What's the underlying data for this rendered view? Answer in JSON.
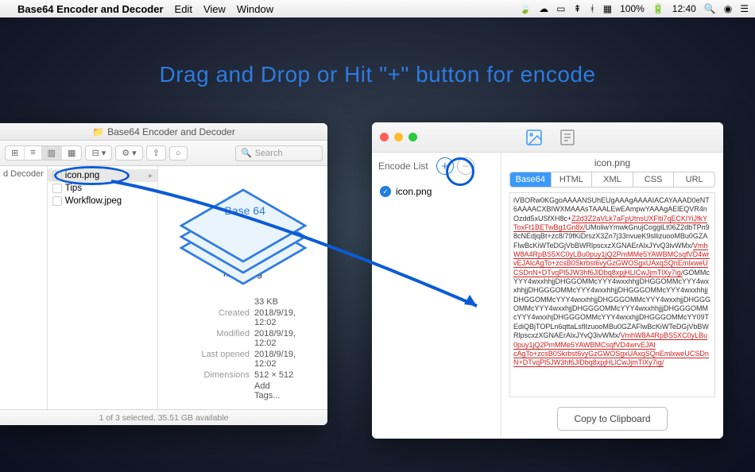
{
  "menubar": {
    "app_title": "Base64 Encoder and Decoder",
    "items": [
      "Edit",
      "View",
      "Window"
    ],
    "battery": "100%",
    "time": "12:40"
  },
  "headline": "Drag and Drop or Hit \"+\" button for encode",
  "finder": {
    "title": "Base64 Encoder and Decoder",
    "search_placeholder": "Search",
    "sidebar_item": "d Decoder",
    "files": [
      {
        "name": "icon.png",
        "selected": true
      },
      {
        "name": "Tips",
        "selected": false
      },
      {
        "name": "Workflow.jpeg",
        "selected": false
      }
    ],
    "preview": {
      "stack_label": "Base 64",
      "filename": "icon.png",
      "size": "33 KB",
      "meta": [
        {
          "k": "Created",
          "v": "2018/9/19, 12:02"
        },
        {
          "k": "Modified",
          "v": "2018/9/19, 12:02"
        },
        {
          "k": "Last opened",
          "v": "2018/9/19, 12:02"
        },
        {
          "k": "Dimensions",
          "v": "512 × 512"
        }
      ],
      "add_tags": "Add Tags..."
    },
    "status": "1 of 3 selected, 35.51 GB available"
  },
  "encoder": {
    "list_label": "Encode List",
    "items": [
      {
        "name": "icon.png"
      }
    ],
    "filename": "icon.png",
    "tabs": [
      "Base64",
      "HTML",
      "XML",
      "CSS",
      "URL"
    ],
    "active_tab": 0,
    "output_plain": "iVBORw0KGgoAAAANSUhEUgAAAgAAAAIACAYAAAD0eNT6AAAACXBIWXMAAAsTAAALEwEAmpwYAAAgAElEQVR4nOzdd5xUSfXH8c+",
    "output_red1": "Z2d3Z2aVLk7aFpUtnsUXFlti7qECKlYiJfkYToxFt1BETwBg1Gn8x/",
    "output_plain2": "UMoliwYmwkGnujCogglLt06Z2dbTPn98cNEdjqBt+zc8/79fKiDrszX3Zn7j33nvueK9sllizuooMBu0GZAFlwBcKiWTeDGjVbBWRlpscxzXGNAErAlxJYvQ3ivWMx/",
    "output_red2": "VmhW8A4RpBS5XC0yLBu0puy1jQ2PmMMe5YAWBMCsqfVD4wrvEJAlcAgTo+zcsB0Skrbst6vyGzGWOSgxUAxqSQnEmlxweUCSDnN+DTvqPl5JW3hf6JlDbq8xpjHLlCwJjmTlXy7ig/",
    "output_plain3": "GOMMcYYY4wxxhhjjDHGGOMMcYYY4wxxhhjjDHGGOMMcYYY4wxxhhjjDHGGGOMMcYYY4wxxhhjjDHGGGOMMcYYY4wxxhhjjDHGGOMMcYYY4wxxhhjjDHGGGOMMcYYY4wxxhjjDHGGGOMMcYYY4wxxhjjDHGGGOMMcYYY4wxxhhjjjDHGGGOMMcYYY4wxxhjDHGGGOMMcYYY4wxxhjjDHGGGOMMcYY09TEdiQBjTOPLn6qttaLsflIzuooMBu0GZAFlwBcKiWTeDGjVbBWRlpscxzXGNAErAlxJYvQ3ivWMx/",
    "output_red3": "VmhW8A4RpBS5XC0yLBu0puy1jQ2PmMMe5YAWBMCsqfVD4wrvEJAl",
    "output_red4": "cAgTo+zcsB0Skrbst6vyGzGWOSgxUAxqSQnEmlxweUCSDnN+DTvqPl5JW3hf6JlDbq8xpjHLlCwJjmTlXy7ig/",
    "copy_label": "Copy to Clipboard"
  }
}
